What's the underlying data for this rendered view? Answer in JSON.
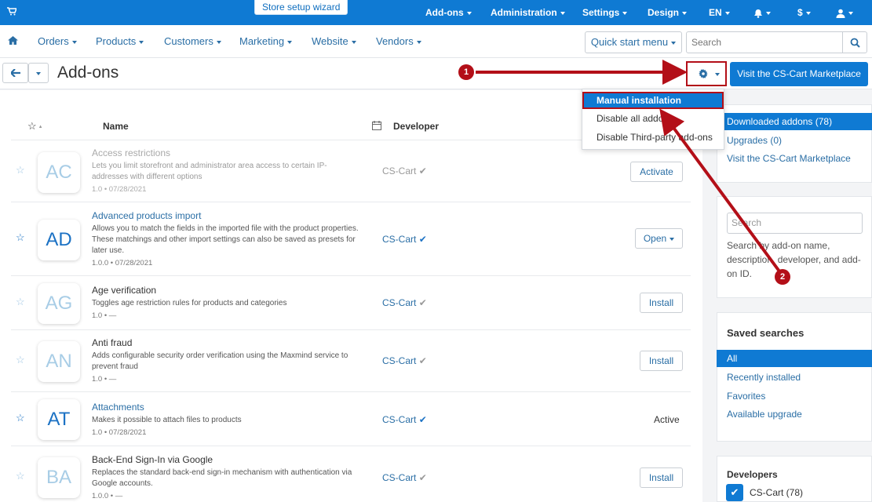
{
  "topbar": {
    "wizard": "Store setup wizard",
    "menu": [
      "Add-ons",
      "Administration",
      "Settings",
      "Design",
      "EN",
      "$"
    ]
  },
  "nav": {
    "items": [
      "Orders",
      "Products",
      "Customers",
      "Marketing",
      "Website",
      "Vendors"
    ],
    "quick_start": "Quick start menu",
    "search_placeholder": "Search"
  },
  "header": {
    "title": "Add-ons",
    "marketplace_button": "Visit the CS-Cart Marketplace"
  },
  "dropdown": {
    "items": [
      "Manual installation",
      "Disable all addons",
      "Disable Third-party add-ons"
    ]
  },
  "table": {
    "headers": {
      "name": "Name",
      "developer": "Developer"
    },
    "rows": [
      {
        "code": "AC",
        "name": "Access restrictions",
        "desc": "Lets you limit storefront and administrator area access to certain IP-addresses with different options",
        "version": "1.0 • 07/28/2021",
        "developer": "CS-Cart",
        "action": "Activate"
      },
      {
        "code": "AD",
        "name": "Advanced products import",
        "desc": "Allows you to match the fields in the imported file with the product properties. These matchings and other import settings can also be saved as presets for later use.",
        "version": "1.0.0 • 07/28/2021",
        "developer": "CS-Cart",
        "action": "Open"
      },
      {
        "code": "AG",
        "name": "Age verification",
        "desc": "Toggles age restriction rules for products and categories",
        "version": "1.0 • —",
        "developer": "CS-Cart",
        "action": "Install"
      },
      {
        "code": "AN",
        "name": "Anti fraud",
        "desc": "Adds configurable security order verification using the Maxmind service to prevent fraud",
        "version": "1.0 • —",
        "developer": "CS-Cart",
        "action": "Install"
      },
      {
        "code": "AT",
        "name": "Attachments",
        "desc": "Makes it possible to attach files to products",
        "version": "1.0 • 07/28/2021",
        "developer": "CS-Cart",
        "action": "Active"
      },
      {
        "code": "BA",
        "name": "Back-End Sign-In via Google",
        "desc": "Replaces the standard back-end sign-in mechanism with authentication via Google accounts.",
        "version": "1.0.0 • —",
        "developer": "CS-Cart",
        "action": "Install"
      }
    ]
  },
  "sidebar": {
    "links": [
      "Downloaded addons (78)",
      "Upgrades (0)",
      "Visit the CS-Cart Marketplace"
    ],
    "search_placeholder": "Search",
    "search_hint": "Search by add-on name, description, developer, and add-on ID.",
    "saved_title": "Saved searches",
    "saved": [
      "All",
      "Recently installed",
      "Favorites",
      "Available upgrade"
    ],
    "developers_title": "Developers",
    "developer_option": "CS-Cart (78)"
  },
  "annotations": [
    "1",
    "2"
  ],
  "colors": {
    "primary": "#0f7ad3",
    "annotation": "#b30f18",
    "link": "#2a6ea5"
  }
}
